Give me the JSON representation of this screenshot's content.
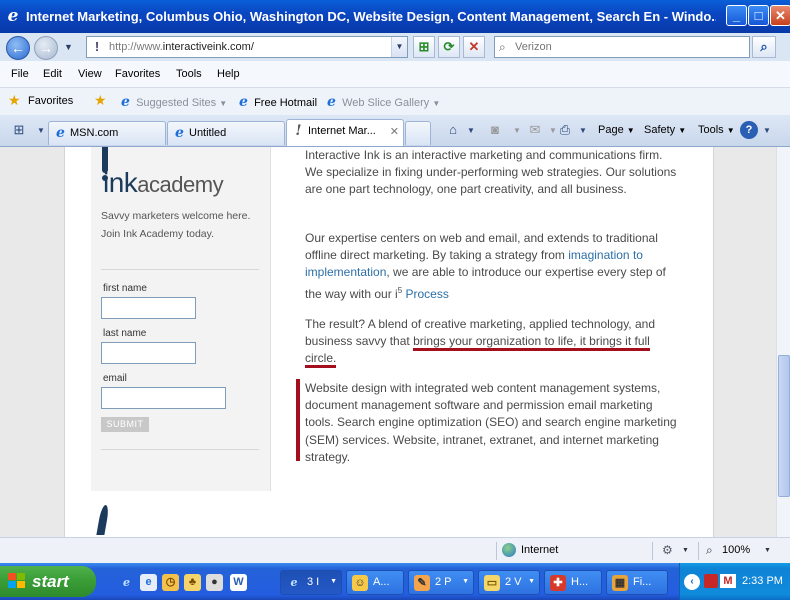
{
  "window": {
    "title": "Internet Marketing, Columbus Ohio, Washington DC, Website Design, Content Management, Search En - Windo...",
    "controls": {
      "minimize": "_",
      "maximize": "□",
      "close": "✕"
    }
  },
  "address_bar": {
    "url_prefix": "http://www.",
    "url_domain": "interactiveink.com/",
    "search_placeholder": "Verizon"
  },
  "menu": [
    "File",
    "Edit",
    "View",
    "Favorites",
    "Tools",
    "Help"
  ],
  "favorites_bar": {
    "favorites_label": "Favorites",
    "items": [
      "Suggested Sites",
      "Free Hotmail",
      "Web Slice Gallery"
    ]
  },
  "tabs": [
    {
      "label": "MSN.com",
      "active": false
    },
    {
      "label": "Untitled",
      "active": false
    },
    {
      "label": "Internet Mar...",
      "active": true
    }
  ],
  "command_bar": {
    "page": "Page",
    "safety": "Safety",
    "tools": "Tools"
  },
  "sidebar": {
    "logo_main": "ink",
    "logo_sub": "academy",
    "tagline_1": "Savvy marketers welcome here.",
    "tagline_2": "Join Ink Academy today.",
    "fields": [
      {
        "label": "first name",
        "value": ""
      },
      {
        "label": "last name",
        "value": ""
      },
      {
        "label": "email",
        "value": ""
      }
    ],
    "submit_label": "SUBMIT"
  },
  "main": {
    "p1": "Interactive Ink is an interactive marketing and communications firm. We specialize in fixing under-performing web strategies. Our solutions are one part technology, one part creativity, and all business.",
    "p2_a": "Our expertise centers on web and email, and extends to traditional offline direct marketing. By taking a strategy from ",
    "p2_link": "imagination to implementation",
    "p2_b": ", we are able to introduce our expertise every step of the way with our ",
    "p2_i": "i",
    "p2_sup": "5",
    "p2_process": " Process",
    "p3_a": "The result? A blend of creative marketing, applied technology, and business savvy that ",
    "p3_underlined": "brings your organization to life, it brings it full circle.",
    "p4": "Website design with integrated web content management systems, document management software and permission email marketing tools. Search engine optimization (SEO) and search engine marketing (SEM) services. Website, intranet, extranet, and internet marketing strategy."
  },
  "status_bar": {
    "zone": "Internet",
    "zoom": "100%"
  },
  "taskbar": {
    "start_label": "start",
    "buttons": [
      {
        "label": "3 I",
        "icon": "ie-icon"
      },
      {
        "label": "A...",
        "icon": "aim-icon"
      },
      {
        "label": "2 P",
        "icon": "paint-icon"
      },
      {
        "label": "2 V",
        "icon": "folder-icon"
      },
      {
        "label": "H...",
        "icon": "help-icon"
      },
      {
        "label": "Fi...",
        "icon": "app-icon"
      }
    ],
    "clock": "2:33 PM"
  },
  "colors": {
    "accent_red": "#a50e1c",
    "link_blue": "#2c6fa8",
    "title_blue": "#0a46c2"
  }
}
